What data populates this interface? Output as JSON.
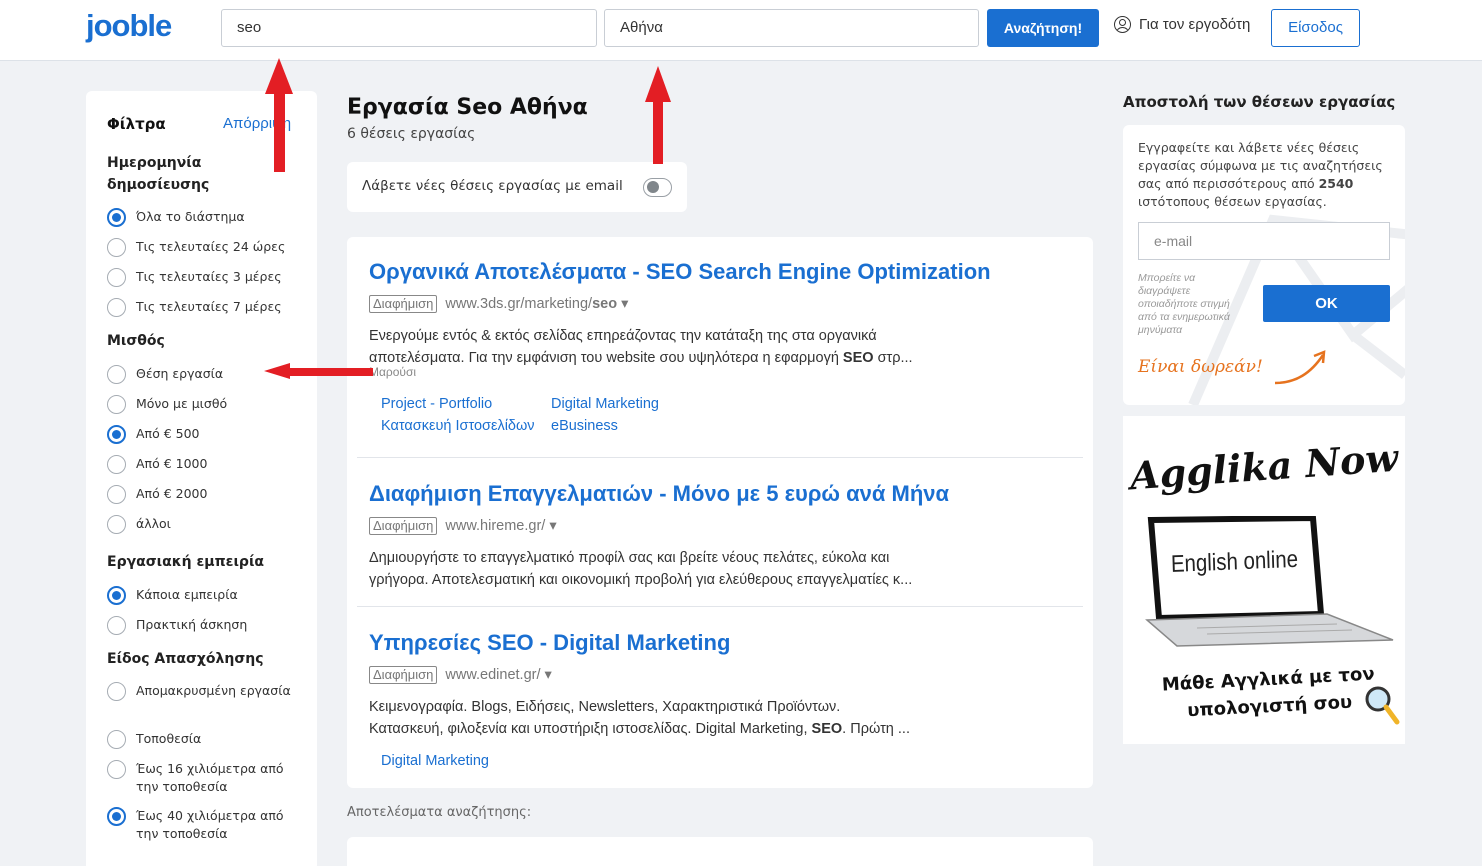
{
  "header": {
    "logo": "jooble",
    "search_value": "seo",
    "location_value": "Αθήνα",
    "search_button": "Αναζήτηση!",
    "employer_link": "Για τον εργοδότη",
    "login_button": "Είσοδος"
  },
  "filters": {
    "title": "Φίλτρα",
    "reset": "Απόρριψη",
    "groups": [
      {
        "label": "Ημερομηνία δημοσίευσης",
        "options": [
          {
            "label": "Όλα το διάστημα",
            "checked": true
          },
          {
            "label": "Τις τελευταίες 24 ώρες",
            "checked": false
          },
          {
            "label": "Τις τελευταίες 3 μέρες",
            "checked": false
          },
          {
            "label": "Τις τελευταίες 7 μέρες",
            "checked": false
          }
        ]
      },
      {
        "label": "Μισθός",
        "options": [
          {
            "label": "Θέση εργασία",
            "checked": false
          },
          {
            "label": "Μόνο με μισθό",
            "checked": false
          },
          {
            "label": "Από € 500",
            "checked": true
          },
          {
            "label": "Από € 1000",
            "checked": false
          },
          {
            "label": "Από € 2000",
            "checked": false
          },
          {
            "label": "άλλοι",
            "checked": false
          }
        ]
      },
      {
        "label": "Εργασιακή εμπειρία",
        "options": [
          {
            "label": "Κάποια εμπειρία",
            "checked": true
          },
          {
            "label": "Πρακτική άσκηση",
            "checked": false
          }
        ]
      },
      {
        "label": "Είδος Απασχόλησης",
        "options": [
          {
            "label": "Απομακρυσμένη εργασία",
            "checked": false
          },
          {
            "label": "Τοποθεσία",
            "checked": false
          },
          {
            "label": "Έως 16 χιλιόμετρα από την τοποθεσία",
            "checked": false
          },
          {
            "label": "Έως 40 χιλιόμετρα από την τοποθεσία",
            "checked": true
          }
        ]
      }
    ]
  },
  "main": {
    "title": "Εργασία Seo Αθήνα",
    "count": "6 θέσεις εργασίας",
    "alert_label": "Λάβετε νέες θέσεις εργασίας με email",
    "alert_enabled": false,
    "ads": [
      {
        "title": "Οργανικά Αποτελέσματα - SEO Search Engine Optimization",
        "badge": "Διαφήμιση",
        "url_prefix": "www.3ds.gr/marketing/",
        "url_bold": "seo",
        "desc_line1": "Ενεργούμε εντός & εκτός σελίδας επηρεάζοντας την κατάταξη της στα οργανικά",
        "desc_line2_a": "αποτελέσματα. Για την εμφάνιση του website σου υψηλότερα η εφαρμογή ",
        "desc_line2_bold": "SEO",
        "desc_line2_b": " στρ...",
        "location": "Μαρούσι",
        "links": [
          "Project - Portfolio",
          "Digital Marketing",
          "Κατασκευή Ιστοσελίδων",
          "eBusiness"
        ]
      },
      {
        "title": "Διαφήμιση Επαγγελματιών - Μόνο με 5 ευρώ ανά Μήνα",
        "badge": "Διαφήμιση",
        "url": "www.hireme.gr/",
        "desc_line1": "Δημιουργήστε το επαγγελματικό προφίλ σας και βρείτε νέους πελάτες, εύκολα και",
        "desc_line2": "γρήγορα. Αποτελεσματική και οικονομική προβολή για ελεύθερους επαγγελματίες κ..."
      },
      {
        "title": "Υπηρεσίες SEO - Digital Marketing",
        "badge": "Διαφήμιση",
        "url": "www.edinet.gr/",
        "desc_line1": "Κειμενογραφία. Blogs, Ειδήσεις, Newsletters, Χαρακτηριστικά Προϊόντων.",
        "desc_line2_a": "Κατασκευή, φιλοξενία και υποστήριξη ιστοσελίδας. Digital Marketing, ",
        "desc_line2_bold": "SEO",
        "desc_line2_b": ". Πρώτη ...",
        "links": [
          "Digital Marketing"
        ]
      }
    ],
    "search_results_label": "Αποτελέσματα αναζήτησης:"
  },
  "subscribe": {
    "title": "Αποστολή των θέσεων εργασίας",
    "text_a": "Εγγραφείτε και λάβετε νέες θέσεις εργασίας σύμφωνα με τις αναζητήσεις σας από περισσότερους από ",
    "text_bold": "2540",
    "text_b": " ιστότοπους θέσεων εργασίας.",
    "email_placeholder": "e-mail",
    "note": "Μπορείτε να διαγράψετε οποιαδήποτε στιγμή από τα ενημερωτικά μηνύματα",
    "ok_button": "OK",
    "free_label": "Είναι δωρεάν!"
  },
  "banner": {
    "brand": "Agglika Now",
    "screen_text": "English online",
    "slogan": "Μάθε Αγγλικά με τον υπολογιστή σου"
  },
  "colors": {
    "accent": "#1a6fd1",
    "annotation_arrow": "#e31e24",
    "free_label": "#e6731f"
  }
}
